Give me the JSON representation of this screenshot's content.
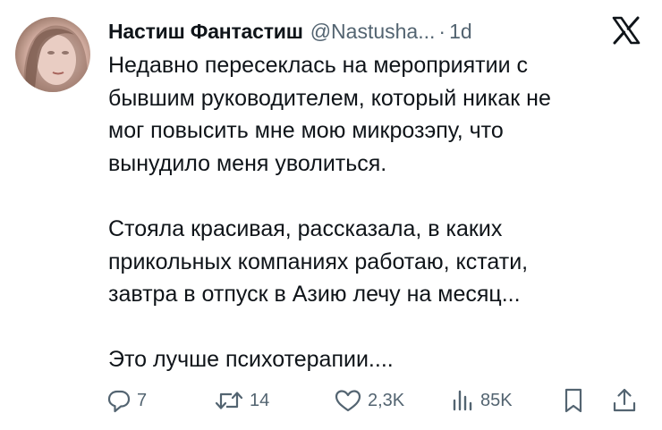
{
  "tweet": {
    "author_name": "Настиш Фантастиш",
    "handle": "@Nastusha...",
    "separator": "·",
    "time": "1d",
    "text_lines": [
      "Недавно пересеклась на мероприятии с",
      "бывшим руководителем, который никак не",
      "мог повысить мне мою микрозэпу, что",
      "вынудило меня уволиться.",
      "Стояла красивая, рассказала, в каких",
      "прикольных компаниях работаю, кстати,",
      "завтра в отпуск в Азию лечу на месяц...",
      "Это лучше психотерапии...."
    ]
  },
  "actions": {
    "reply": {
      "icon": "reply-icon",
      "count": "7"
    },
    "retweet": {
      "icon": "retweet-icon",
      "count": "14"
    },
    "like": {
      "icon": "heart-icon",
      "count": "2,3K"
    },
    "views": {
      "icon": "views-icon",
      "count": "85K"
    },
    "bookmark": {
      "icon": "bookmark-icon"
    },
    "share": {
      "icon": "share-icon"
    }
  },
  "branding": {
    "icon": "x-logo-icon"
  },
  "colors": {
    "text": "#0f1419",
    "secondary": "#536471",
    "background": "#ffffff"
  }
}
